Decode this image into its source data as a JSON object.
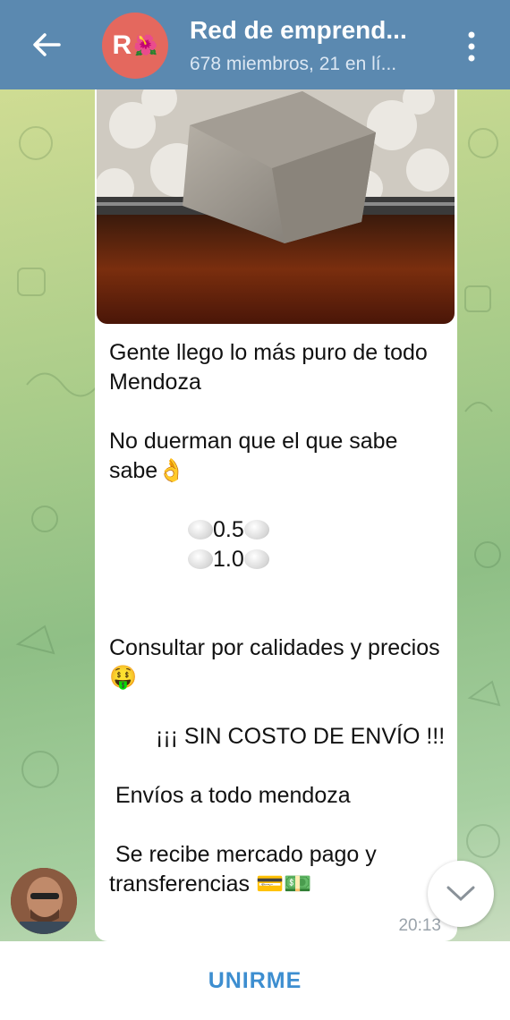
{
  "header": {
    "title": "Red de emprend...",
    "subtitle": "678 miembros, 21 en lí...",
    "avatar_letter": "R",
    "avatar_emoji": "🌺"
  },
  "message": {
    "lines": [
      "Gente llego lo más puro de todo Mendoza",
      "No duerman que el que sabe sabe👌",
      "0.5",
      "1.0",
      "Consultar por calidades y precios🤑",
      "¡¡¡ SIN COSTO DE ENVÍO !!!",
      " Envíos a todo mendoza",
      " Se recibe mercado pago y transferencias 💳💵"
    ],
    "time": "20:13"
  },
  "bottom": {
    "join_label": "UNIRME"
  },
  "icons": {
    "back": "arrow-left-icon",
    "menu": "more-vertical-icon",
    "scroll": "chevron-down-icon"
  },
  "colors": {
    "header": "#5b89b0",
    "join": "#3d8ed0",
    "avatar": "#e4685e"
  }
}
